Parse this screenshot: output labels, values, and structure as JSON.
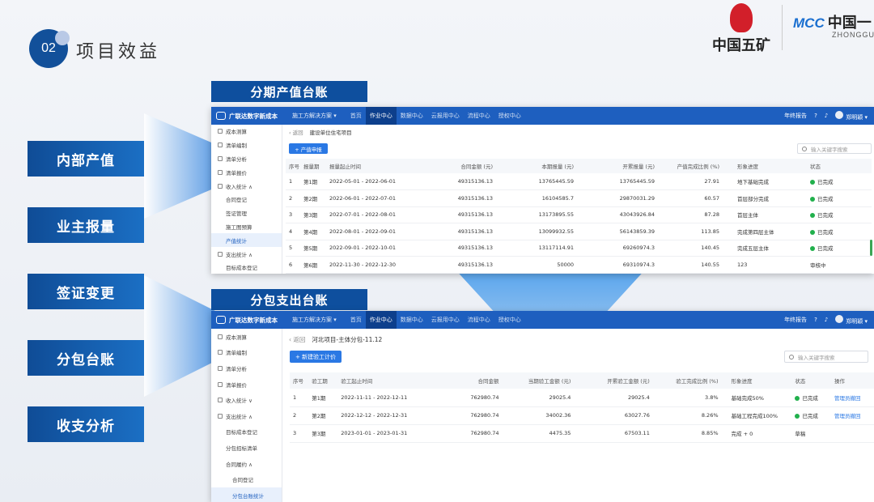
{
  "header": {
    "section_number": "02",
    "section_title": "项目效益",
    "logo_minmetals": "中国五矿",
    "logo_mcc_abbr": "MCC",
    "logo_mcc_cn": "中国一",
    "logo_mcc_en": "ZHONGGUO"
  },
  "labels": [
    "内部产值",
    "业主报量",
    "签证变更",
    "分包台账",
    "收支分析"
  ],
  "top": {
    "title": "分期产值台账",
    "app": {
      "brand": "广联达数字新成本",
      "solution": "施工方解决方案 ▾",
      "tabs": [
        {
          "label": "首页"
        },
        {
          "label": "作业中心"
        },
        {
          "label": "数据中心"
        },
        {
          "label": "云报用中心"
        },
        {
          "label": "流程中心"
        },
        {
          "label": "授权中心"
        }
      ],
      "report": "年终报告",
      "user": "郑明颖 ▾"
    },
    "sidebar": [
      {
        "label": "成本测算"
      },
      {
        "label": "清单编制"
      },
      {
        "label": "清单分析"
      },
      {
        "label": "清单报价"
      },
      {
        "label": "收入统计 ∧"
      },
      {
        "label": "合同登记"
      },
      {
        "label": "签证管理"
      },
      {
        "label": "施工图预算"
      },
      {
        "label": "产值统计"
      },
      {
        "label": "支出统计 ∧"
      },
      {
        "label": "目标成本登记"
      }
    ],
    "back": "‹ 返回",
    "project": "建设单位住宅项目",
    "new_button": "+ 产值申报",
    "search_placeholder": "输入关键字搜索",
    "columns": [
      "序号",
      "报量期",
      "报量起止时间",
      "合同金额 (元)",
      "本期报量 (元)",
      "开累报量 (元)",
      "产值完成比例 (%)",
      "形象进度",
      "状态"
    ],
    "rows": [
      [
        "1",
        "第1期",
        "2022-05-01 - 2022-06-01",
        "49315136.13",
        "13765445.59",
        "13765445.59",
        "27.91",
        "地下基础完成",
        "已完成"
      ],
      [
        "2",
        "第2期",
        "2022-06-01 - 2022-07-01",
        "49315136.13",
        "16104585.7",
        "29870031.29",
        "60.57",
        "首层部分完成",
        "已完成"
      ],
      [
        "3",
        "第3期",
        "2022-07-01 - 2022-08-01",
        "49315136.13",
        "13173895.55",
        "43043926.84",
        "87.28",
        "首层主体",
        "已完成"
      ],
      [
        "4",
        "第4期",
        "2022-08-01 - 2022-09-01",
        "49315136.13",
        "13099932.55",
        "56143859.39",
        "113.85",
        "完成第四层主体",
        "已完成"
      ],
      [
        "5",
        "第5期",
        "2022-09-01 - 2022-10-01",
        "49315136.13",
        "13117114.91",
        "69260974.3",
        "140.45",
        "完成五层主体",
        "已完成"
      ],
      [
        "6",
        "第6期",
        "2022-11-30 - 2022-12-30",
        "49315136.13",
        "50000",
        "69310974.3",
        "140.55",
        "123",
        "审核中"
      ]
    ]
  },
  "bottom": {
    "title": "分包支出台账",
    "app": {
      "brand": "广联达数字新成本",
      "solution": "施工方解决方案 ▾",
      "tabs": [
        {
          "label": "首页"
        },
        {
          "label": "作业中心"
        },
        {
          "label": "数据中心"
        },
        {
          "label": "云报用中心"
        },
        {
          "label": "流程中心"
        },
        {
          "label": "授权中心"
        }
      ],
      "report": "年终报告",
      "user": "郑明颖 ▾"
    },
    "sidebar": [
      {
        "label": "成本测算"
      },
      {
        "label": "清单编制"
      },
      {
        "label": "清单分析"
      },
      {
        "label": "清单报价"
      },
      {
        "label": "收入统计 ∨"
      },
      {
        "label": "支出统计 ∧"
      },
      {
        "label": "目标成本登记"
      },
      {
        "label": "分包招标清单"
      },
      {
        "label": "合同履约 ∧"
      },
      {
        "label": "合同登记"
      },
      {
        "label": "分包台账统计"
      }
    ],
    "back": "‹ 返回",
    "project": "河北项目-主体分包-11.12",
    "new_button": "+ 新建验工计价",
    "search_placeholder": "输入关键字搜索",
    "columns": [
      "序号",
      "验工期",
      "验工起止时间",
      "合同金额",
      "当期验工金额 (元)",
      "开累验工金额 (元)",
      "验工完成比例 (%)",
      "形象进度",
      "状态",
      "操作"
    ],
    "rows": [
      [
        "1",
        "第1期",
        "2022-11-11 - 2022-12-11",
        "762980.74",
        "29025.4",
        "29025.4",
        "3.8%",
        "基础完成50%",
        "已完成",
        "管理员撤回"
      ],
      [
        "2",
        "第2期",
        "2022-12-12 - 2022-12-31",
        "762980.74",
        "34002.36",
        "63027.76",
        "8.26%",
        "基础工程完成100%",
        "已完成",
        "管理员撤回"
      ],
      [
        "3",
        "第3期",
        "2023-01-01 - 2023-01-31",
        "762980.74",
        "4475.35",
        "67503.11",
        "8.85%",
        "完成 + 0",
        "草稿",
        ""
      ]
    ]
  }
}
